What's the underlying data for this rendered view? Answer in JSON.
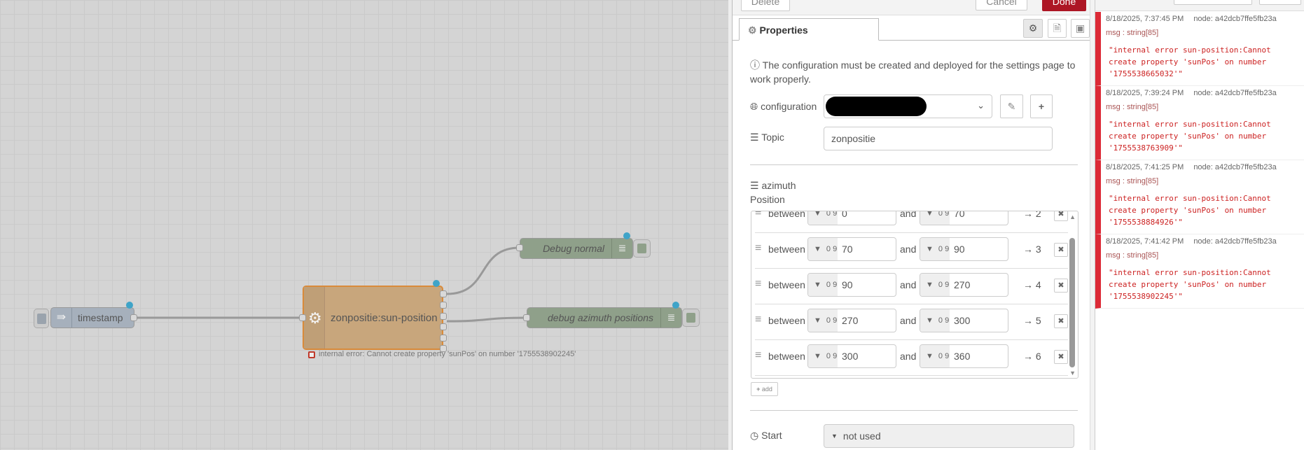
{
  "canvas": {
    "nodes": {
      "timestamp": "timestamp",
      "sun": "zonpositie:sun-position",
      "debug_normal": "Debug normal",
      "debug_azimuth": "debug azimuth positions"
    },
    "error_status": "internal error: Cannot create property 'sunPos' on number '1755538902245'"
  },
  "editor": {
    "delete": "Delete",
    "cancel": "Cancel",
    "done": "Done",
    "tab": "Properties",
    "info": "The configuration must be created and deployed for the settings page to work properly.",
    "config_label": "configuration",
    "topic_label": "Topic",
    "topic_value": "zonpositie",
    "property_label": "azimuth",
    "position_label": "Position",
    "rules": [
      {
        "op": "between",
        "from": "0",
        "to": "70",
        "out": "→ 2"
      },
      {
        "op": "between",
        "from": "70",
        "to": "90",
        "out": "→ 3"
      },
      {
        "op": "between",
        "from": "90",
        "to": "270",
        "out": "→ 4"
      },
      {
        "op": "between",
        "from": "270",
        "to": "300",
        "out": "→ 5"
      },
      {
        "op": "between",
        "from": "300",
        "to": "360",
        "out": "→ 6"
      }
    ],
    "and": "and",
    "type_icon": "0 9",
    "add": "add",
    "start_label": "Start",
    "start_value": "not used",
    "colors": {
      "done": "#ad1625",
      "node": "#c8a67c"
    }
  },
  "debug": {
    "messages": [
      {
        "time": "8/18/2025, 7:37:45 PM",
        "node": "node: a42dcb7ffe5fb23a",
        "type": "msg : string[85]",
        "value": "\"internal error sun-position:Cannot\ncreate property 'sunPos' on number\n'1755538665032'\""
      },
      {
        "time": "8/18/2025, 7:39:24 PM",
        "node": "node: a42dcb7ffe5fb23a",
        "type": "msg : string[85]",
        "value": "\"internal error sun-position:Cannot\ncreate property 'sunPos' on number\n'1755538763909'\""
      },
      {
        "time": "8/18/2025, 7:41:25 PM",
        "node": "node: a42dcb7ffe5fb23a",
        "type": "msg : string[85]",
        "value": "\"internal error sun-position:Cannot\ncreate property 'sunPos' on number\n'1755538884926'\""
      },
      {
        "time": "8/18/2025, 7:41:42 PM",
        "node": "node: a42dcb7ffe5fb23a",
        "type": "msg : string[85]",
        "value": "\"internal error sun-position:Cannot\ncreate property 'sunPos' on number\n'1755538902245'\""
      }
    ]
  }
}
